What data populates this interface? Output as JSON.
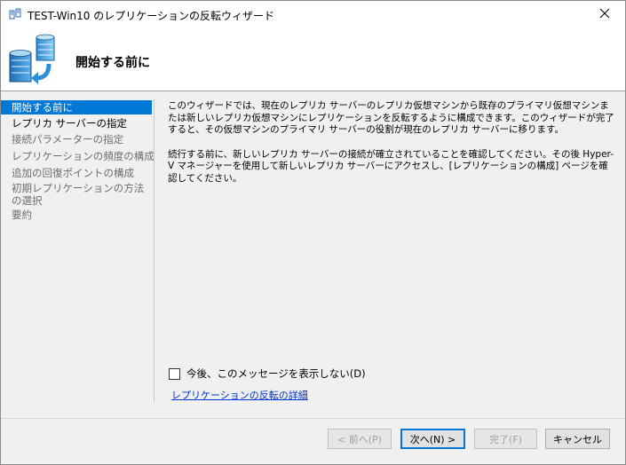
{
  "window": {
    "title": "TEST-Win10 のレプリケーションの反転ウィザード",
    "icon": "replication-icon",
    "close_icon": "close-icon"
  },
  "header": {
    "title": "開始する前に",
    "icon": "servers-replication-icon"
  },
  "nav": {
    "items": [
      {
        "label": "開始する前に",
        "state": "active"
      },
      {
        "label": "レプリカ サーバーの指定",
        "state": "enabled"
      },
      {
        "label": "接続パラメーターの指定",
        "state": "disabled"
      },
      {
        "label": "レプリケーションの頻度の構成",
        "state": "disabled"
      },
      {
        "label": "追加の回復ポイントの構成",
        "state": "disabled"
      },
      {
        "label": "初期レプリケーションの方法の選択",
        "state": "disabled"
      },
      {
        "label": "要約",
        "state": "disabled"
      }
    ]
  },
  "content": {
    "paragraph1": "このウィザードでは、現在のレプリカ サーバーのレプリカ仮想マシンから既存のプライマリ仮想マシンまたは新しいレプリカ仮想マシンにレプリケーションを反転するように構成できます。このウィザードが完了すると、その仮想マシンのプライマリ サーバーの役割が現在のレプリカ サーバーに移ります。",
    "paragraph2": "続行する前に、新しいレプリカ サーバーの接続が確立されていることを確認してください。その後 Hyper-V マネージャーを使用して新しいレプリカ サーバーにアクセスし、[レプリケーションの構成] ページを確認してください。",
    "checkbox_label": "今後、このメッセージを表示しない(D)",
    "checkbox_checked": false,
    "link_text": "レプリケーションの反転の詳細"
  },
  "buttons": {
    "prev": "< 前へ(P)",
    "next": "次へ(N) >",
    "finish": "完了(F)",
    "cancel": "キャンセル"
  },
  "colors": {
    "accent": "#0078d7",
    "link": "#0033cc",
    "disabled_text": "#6d6d6d"
  }
}
